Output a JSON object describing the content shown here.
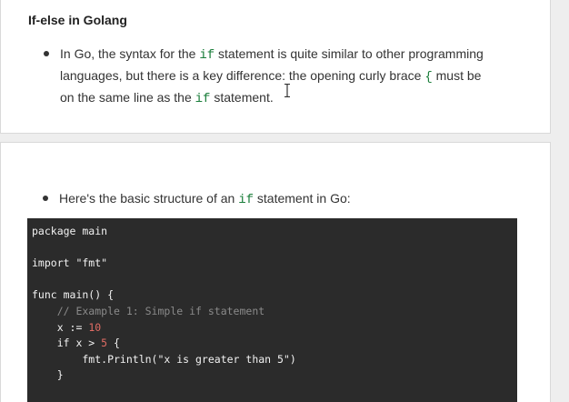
{
  "section": {
    "title": "If-else in Golang"
  },
  "intro_bullet": {
    "text_before": "In Go, the syntax for the ",
    "code_1": "if",
    "text_middle": " statement is quite similar to other programming languages, but there is a key difference: the opening curly brace ",
    "code_2": "{",
    "text_after_brace": " must be on the same line as the ",
    "code_3": "if",
    "text_end": " statement."
  },
  "structure_bullet": {
    "text_before": "Here's the basic structure of an ",
    "code": "if",
    "text_after": " statement in Go:"
  },
  "code_block": {
    "line_1": "package main",
    "line_2": "import \"fmt\"",
    "line_3": "func main() {",
    "line_4": "    // Example 1: Simple if statement",
    "line_5_prefix": "    x := ",
    "line_5_number": "10",
    "line_6_prefix": "    if x > ",
    "line_6_number": "5",
    "line_6_suffix": " {",
    "line_7": "        fmt.Println(\"x is greater than 5\")",
    "line_8": "    }"
  },
  "colors": {
    "inline_code": "#1b7e3b",
    "code_background": "#2b2b2b",
    "code_comment": "#8a8a8a",
    "code_number": "#e06c64"
  },
  "icons": {
    "cursor": "text-cursor-icon"
  }
}
